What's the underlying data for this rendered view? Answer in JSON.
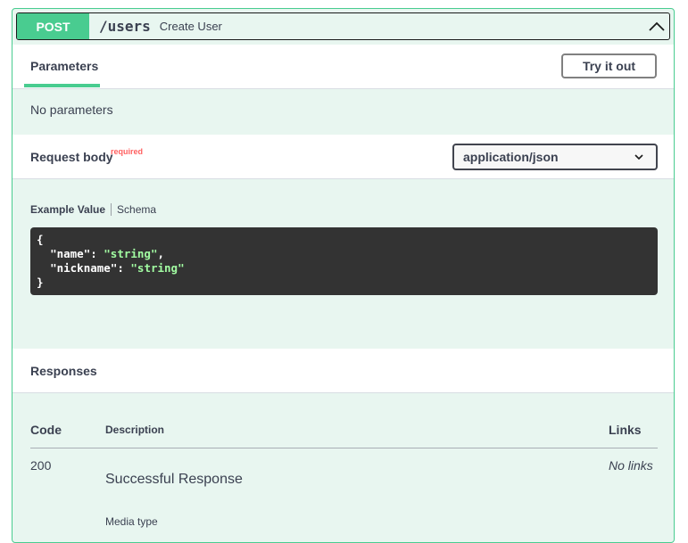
{
  "operation": {
    "method": "POST",
    "path": "/users",
    "summary": "Create User"
  },
  "parameters": {
    "tab_label": "Parameters",
    "try_button": "Try it out",
    "empty_text": "No parameters"
  },
  "request_body": {
    "label": "Request body",
    "required_label": "required",
    "content_type": "application/json",
    "example_tab": "Example Value",
    "schema_tab": "Schema",
    "code_lines": [
      {
        "key": "name",
        "value": "\"string\""
      },
      {
        "key": "nickname",
        "value": "\"string\""
      }
    ]
  },
  "responses": {
    "label": "Responses",
    "columns": {
      "code": "Code",
      "description": "Description",
      "links": "Links"
    },
    "rows": [
      {
        "code": "200",
        "description": "Successful Response",
        "links": "No links",
        "media_type_label": "Media type"
      }
    ]
  },
  "colors": {
    "post_green": "#49cc90",
    "panel_bg": "#e8f6f0",
    "code_bg": "#333333",
    "string_green": "#a2fca2",
    "required_red": "#ff6060"
  }
}
